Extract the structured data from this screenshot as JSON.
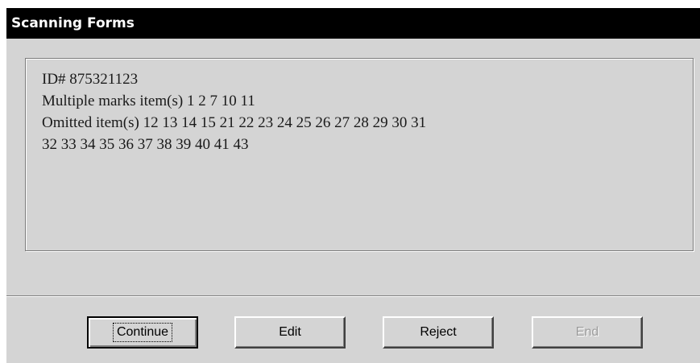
{
  "window": {
    "title": "Scanning Forms"
  },
  "message": {
    "lines": [
      "ID# 875321123",
      "Multiple marks item(s) 1 2 7 10 11",
      "Omitted item(s) 12 13 14 15 21 22 23 24 25 26 27 28 29 30 31",
      "32 33 34 35 36 37 38 39 40 41 43"
    ]
  },
  "buttons": {
    "continue_label": "Continue",
    "edit_label": "Edit",
    "reject_label": "Reject",
    "end_label": "End"
  },
  "colors": {
    "titlebar": "#000000",
    "title_text": "#ffffff",
    "dialog_face": "#d4d4d4",
    "disabled_text": "#9a9a9a"
  }
}
